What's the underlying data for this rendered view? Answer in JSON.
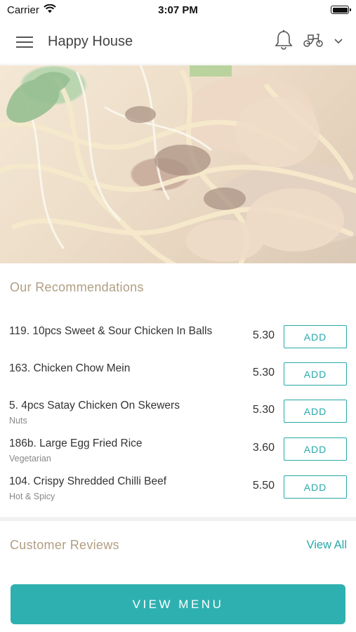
{
  "status_bar": {
    "carrier": "Carrier",
    "time": "3:07 PM"
  },
  "nav": {
    "title": "Happy House",
    "icons": [
      "menu-icon",
      "bell-icon",
      "scooter-icon",
      "chevron-down-icon"
    ]
  },
  "recommendations": {
    "title": "Our Recommendations",
    "items": [
      {
        "name": "119. 10pcs Sweet & Sour Chicken In Balls",
        "note": "",
        "price": "5.30",
        "action": "ADD"
      },
      {
        "name": "163. Chicken Chow Mein",
        "note": "",
        "price": "5.30",
        "action": "ADD"
      },
      {
        "name": "5. 4pcs Satay Chicken On Skewers",
        "note": "Nuts",
        "price": "5.30",
        "action": "ADD"
      },
      {
        "name": "186b. Large Egg Fried Rice",
        "note": "Vegetarian",
        "price": "3.60",
        "action": "ADD"
      },
      {
        "name": "104. Crispy Shredded Chilli Beef",
        "note": "Hot & Spicy",
        "price": "5.50",
        "action": "ADD"
      }
    ]
  },
  "reviews": {
    "title": "Customer Reviews",
    "view_all": "View All"
  },
  "footer": {
    "button_label": "VIEW MENU"
  },
  "colors": {
    "accent": "#2fb0b0",
    "section_title": "#b19e82"
  }
}
